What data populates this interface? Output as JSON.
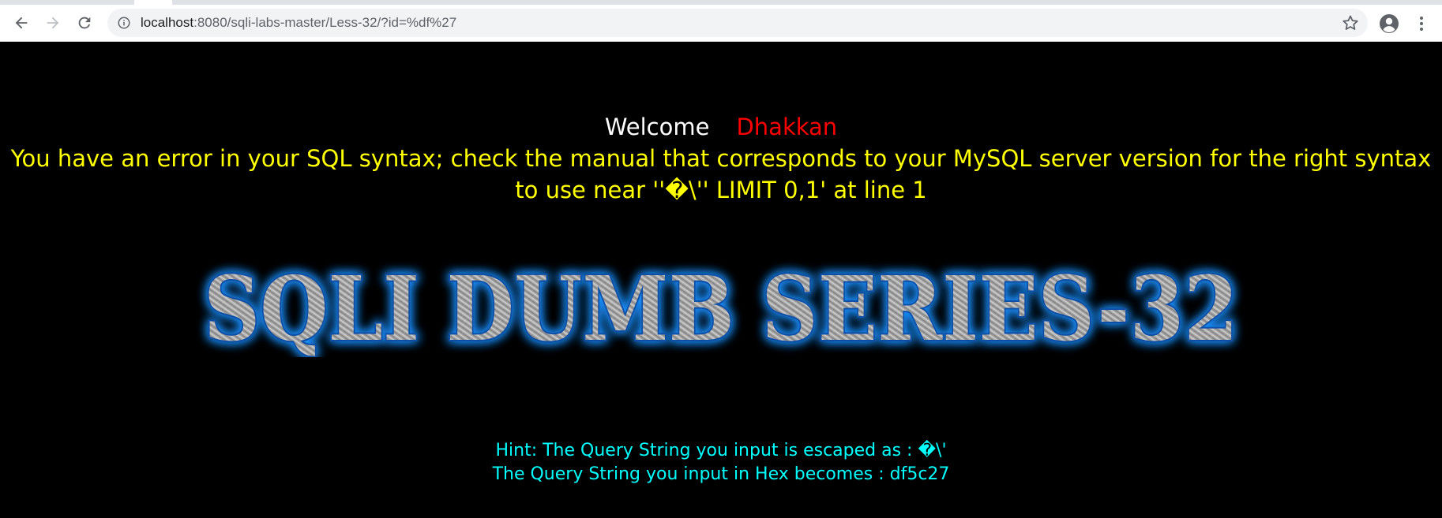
{
  "browser": {
    "url_host": "localhost",
    "url_rest": ":8080/sqli-labs-master/Less-32/?id=%df%27",
    "back_icon": "arrow-left-icon",
    "forward_icon": "arrow-right-icon",
    "reload_icon": "reload-icon",
    "info_icon": "info-icon",
    "bookmark_icon": "star-icon",
    "profile_icon": "account-circle-icon",
    "menu_icon": "kebab-menu-icon"
  },
  "page": {
    "welcome_label": "Welcome",
    "username": "Dhakkan",
    "error_text": "You have an error in your SQL syntax; check the manual that corresponds to your MySQL server version for the right syntax to use near ''�\\'' LIMIT 0,1' at line 1",
    "banner_title": "SQLI DUMB SERIES-32",
    "hint_escaped": "Hint: The Query String you input is escaped as : �\\'",
    "hint_hex": "The Query String you input in Hex becomes : df5c27"
  },
  "colors": {
    "background": "#000000",
    "welcome": "#ffffff",
    "username": "#ff0000",
    "error": "#ffff00",
    "hint": "#00ffff",
    "banner_glow": "#1e90ff"
  }
}
